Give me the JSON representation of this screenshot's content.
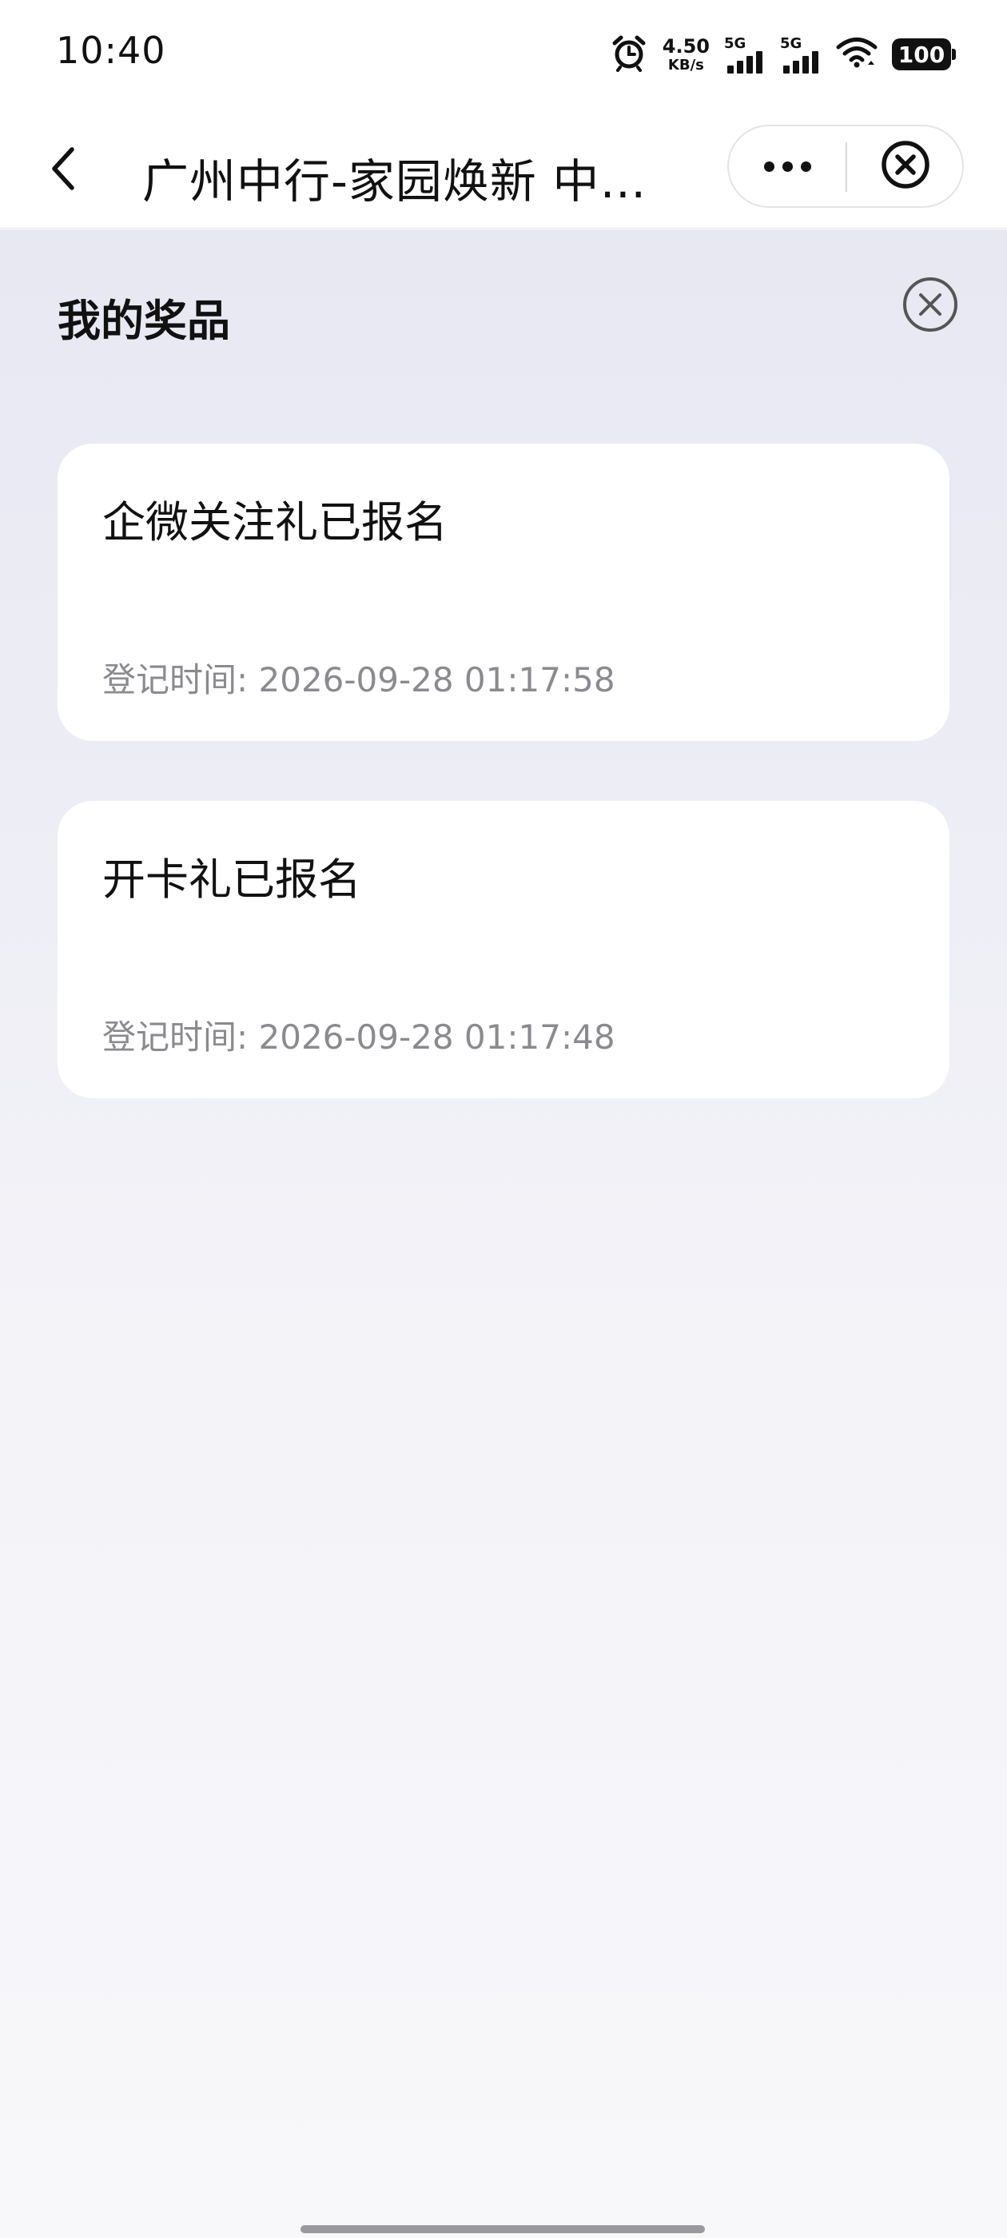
{
  "status_bar": {
    "time": "10:40",
    "net_speed_value": "4.50",
    "net_speed_unit": "KB/s",
    "sim1_label": "5G",
    "sim2_label": "5G",
    "battery": "100",
    "icons": [
      "alarm-icon",
      "signal-icon",
      "signal-icon",
      "wifi-icon",
      "battery-icon"
    ]
  },
  "nav": {
    "title": "广州中行-家园焕新 中国银行广州分行",
    "icons": [
      "back-arrow-icon",
      "more-dots-icon",
      "close-circle-icon"
    ]
  },
  "page": {
    "section_title": "我的奖品",
    "close_icon": "close-circle-icon"
  },
  "prizes": [
    {
      "name": "企微关注礼已报名",
      "time": "登记时间: 2026-09-28 01:17:58"
    },
    {
      "name": "开卡礼已报名",
      "time": "登记时间: 2026-09-28 01:17:48"
    }
  ],
  "colors": {
    "text_primary": "#111111",
    "text_secondary": "#8a8a8f",
    "card_bg": "#ffffff",
    "page_bg_top": "#e8e8f3",
    "page_bg_bottom": "#f8f8fb"
  }
}
